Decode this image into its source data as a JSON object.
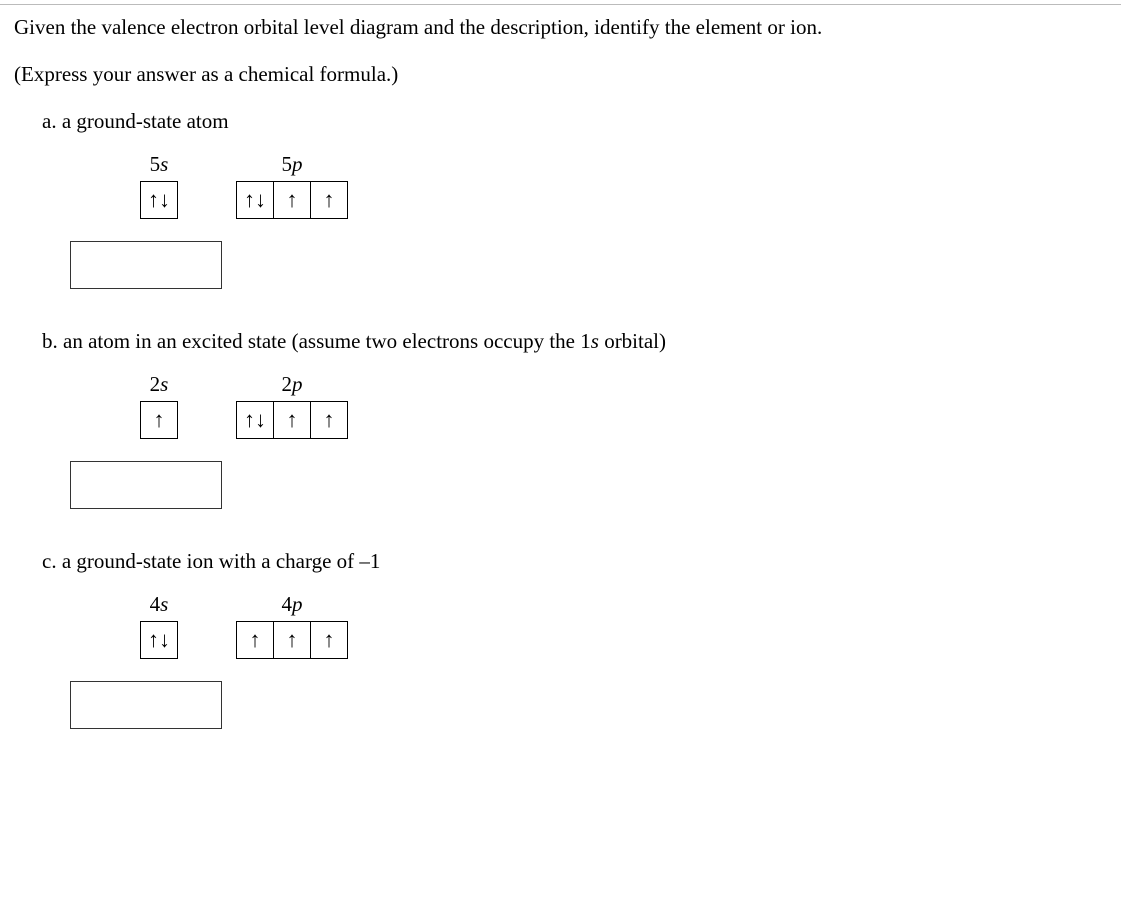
{
  "intro_line1": "Given the valence electron orbital level diagram and the description, identify the element or ion.",
  "intro_line2": "(Express your answer as a chemical formula.)",
  "parts": {
    "a": {
      "label": "a. a ground-state atom",
      "s_orbital": {
        "n": "5",
        "letter": "s",
        "boxes": [
          "↑↓"
        ]
      },
      "p_orbital": {
        "n": "5",
        "letter": "p",
        "boxes": [
          "↑↓",
          "↑",
          "↑"
        ]
      },
      "answer": ""
    },
    "b": {
      "label_prefix": "b. an atom in an excited state (assume two electrons occupy the ",
      "label_math_d": "1",
      "label_math_s": "s",
      "label_suffix": " orbital)",
      "s_orbital": {
        "n": "2",
        "letter": "s",
        "boxes": [
          "↑"
        ]
      },
      "p_orbital": {
        "n": "2",
        "letter": "p",
        "boxes": [
          "↑↓",
          "↑",
          "↑"
        ]
      },
      "answer": ""
    },
    "c": {
      "label": "c. a ground-state ion with a charge of –1",
      "s_orbital": {
        "n": "4",
        "letter": "s",
        "boxes": [
          "↑↓"
        ]
      },
      "p_orbital": {
        "n": "4",
        "letter": "p",
        "boxes": [
          "↑",
          "↑",
          "↑"
        ]
      },
      "answer": ""
    }
  }
}
